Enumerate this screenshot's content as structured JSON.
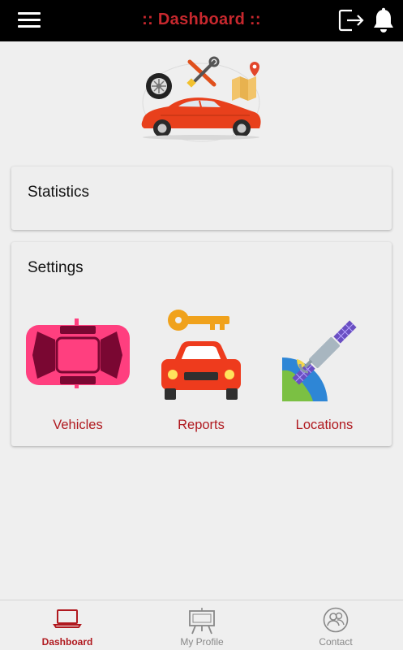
{
  "header": {
    "title": ":: Dashboard ::",
    "menu_icon": "hamburger-menu-icon",
    "logout_icon": "logout-icon",
    "bell_icon": "bell-icon"
  },
  "hero": {
    "image": "car-services-illustration"
  },
  "cards": {
    "statistics": {
      "title": "Statistics"
    },
    "settings": {
      "title": "Settings",
      "tiles": [
        {
          "label": "Vehicles",
          "icon": "car-top-view-icon"
        },
        {
          "label": "Reports",
          "icon": "car-key-icon"
        },
        {
          "label": "Locations",
          "icon": "satellite-globe-icon"
        }
      ]
    }
  },
  "tabbar": {
    "tabs": [
      {
        "label": "Dashboard",
        "icon": "laptop-icon",
        "active": true
      },
      {
        "label": "My Profile",
        "icon": "easel-icon",
        "active": false
      },
      {
        "label": "Contact",
        "icon": "contacts-icon",
        "active": false
      }
    ]
  },
  "colors": {
    "accent": "#b0191f",
    "header_bg": "#000000",
    "title": "#c8282e"
  }
}
